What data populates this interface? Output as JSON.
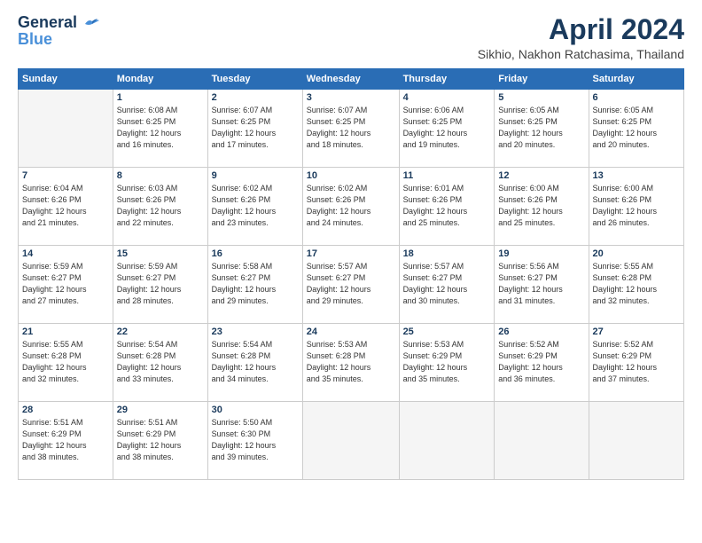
{
  "logo": {
    "line1": "General",
    "line2": "Blue"
  },
  "title": "April 2024",
  "location": "Sikhio, Nakhon Ratchasima, Thailand",
  "headers": [
    "Sunday",
    "Monday",
    "Tuesday",
    "Wednesday",
    "Thursday",
    "Friday",
    "Saturday"
  ],
  "weeks": [
    [
      {
        "day": "",
        "info": ""
      },
      {
        "day": "1",
        "info": "Sunrise: 6:08 AM\nSunset: 6:25 PM\nDaylight: 12 hours\nand 16 minutes."
      },
      {
        "day": "2",
        "info": "Sunrise: 6:07 AM\nSunset: 6:25 PM\nDaylight: 12 hours\nand 17 minutes."
      },
      {
        "day": "3",
        "info": "Sunrise: 6:07 AM\nSunset: 6:25 PM\nDaylight: 12 hours\nand 18 minutes."
      },
      {
        "day": "4",
        "info": "Sunrise: 6:06 AM\nSunset: 6:25 PM\nDaylight: 12 hours\nand 19 minutes."
      },
      {
        "day": "5",
        "info": "Sunrise: 6:05 AM\nSunset: 6:25 PM\nDaylight: 12 hours\nand 20 minutes."
      },
      {
        "day": "6",
        "info": "Sunrise: 6:05 AM\nSunset: 6:25 PM\nDaylight: 12 hours\nand 20 minutes."
      }
    ],
    [
      {
        "day": "7",
        "info": "Sunrise: 6:04 AM\nSunset: 6:26 PM\nDaylight: 12 hours\nand 21 minutes."
      },
      {
        "day": "8",
        "info": "Sunrise: 6:03 AM\nSunset: 6:26 PM\nDaylight: 12 hours\nand 22 minutes."
      },
      {
        "day": "9",
        "info": "Sunrise: 6:02 AM\nSunset: 6:26 PM\nDaylight: 12 hours\nand 23 minutes."
      },
      {
        "day": "10",
        "info": "Sunrise: 6:02 AM\nSunset: 6:26 PM\nDaylight: 12 hours\nand 24 minutes."
      },
      {
        "day": "11",
        "info": "Sunrise: 6:01 AM\nSunset: 6:26 PM\nDaylight: 12 hours\nand 25 minutes."
      },
      {
        "day": "12",
        "info": "Sunrise: 6:00 AM\nSunset: 6:26 PM\nDaylight: 12 hours\nand 25 minutes."
      },
      {
        "day": "13",
        "info": "Sunrise: 6:00 AM\nSunset: 6:26 PM\nDaylight: 12 hours\nand 26 minutes."
      }
    ],
    [
      {
        "day": "14",
        "info": "Sunrise: 5:59 AM\nSunset: 6:27 PM\nDaylight: 12 hours\nand 27 minutes."
      },
      {
        "day": "15",
        "info": "Sunrise: 5:59 AM\nSunset: 6:27 PM\nDaylight: 12 hours\nand 28 minutes."
      },
      {
        "day": "16",
        "info": "Sunrise: 5:58 AM\nSunset: 6:27 PM\nDaylight: 12 hours\nand 29 minutes."
      },
      {
        "day": "17",
        "info": "Sunrise: 5:57 AM\nSunset: 6:27 PM\nDaylight: 12 hours\nand 29 minutes."
      },
      {
        "day": "18",
        "info": "Sunrise: 5:57 AM\nSunset: 6:27 PM\nDaylight: 12 hours\nand 30 minutes."
      },
      {
        "day": "19",
        "info": "Sunrise: 5:56 AM\nSunset: 6:27 PM\nDaylight: 12 hours\nand 31 minutes."
      },
      {
        "day": "20",
        "info": "Sunrise: 5:55 AM\nSunset: 6:28 PM\nDaylight: 12 hours\nand 32 minutes."
      }
    ],
    [
      {
        "day": "21",
        "info": "Sunrise: 5:55 AM\nSunset: 6:28 PM\nDaylight: 12 hours\nand 32 minutes."
      },
      {
        "day": "22",
        "info": "Sunrise: 5:54 AM\nSunset: 6:28 PM\nDaylight: 12 hours\nand 33 minutes."
      },
      {
        "day": "23",
        "info": "Sunrise: 5:54 AM\nSunset: 6:28 PM\nDaylight: 12 hours\nand 34 minutes."
      },
      {
        "day": "24",
        "info": "Sunrise: 5:53 AM\nSunset: 6:28 PM\nDaylight: 12 hours\nand 35 minutes."
      },
      {
        "day": "25",
        "info": "Sunrise: 5:53 AM\nSunset: 6:29 PM\nDaylight: 12 hours\nand 35 minutes."
      },
      {
        "day": "26",
        "info": "Sunrise: 5:52 AM\nSunset: 6:29 PM\nDaylight: 12 hours\nand 36 minutes."
      },
      {
        "day": "27",
        "info": "Sunrise: 5:52 AM\nSunset: 6:29 PM\nDaylight: 12 hours\nand 37 minutes."
      }
    ],
    [
      {
        "day": "28",
        "info": "Sunrise: 5:51 AM\nSunset: 6:29 PM\nDaylight: 12 hours\nand 38 minutes."
      },
      {
        "day": "29",
        "info": "Sunrise: 5:51 AM\nSunset: 6:29 PM\nDaylight: 12 hours\nand 38 minutes."
      },
      {
        "day": "30",
        "info": "Sunrise: 5:50 AM\nSunset: 6:30 PM\nDaylight: 12 hours\nand 39 minutes."
      },
      {
        "day": "",
        "info": ""
      },
      {
        "day": "",
        "info": ""
      },
      {
        "day": "",
        "info": ""
      },
      {
        "day": "",
        "info": ""
      }
    ]
  ]
}
